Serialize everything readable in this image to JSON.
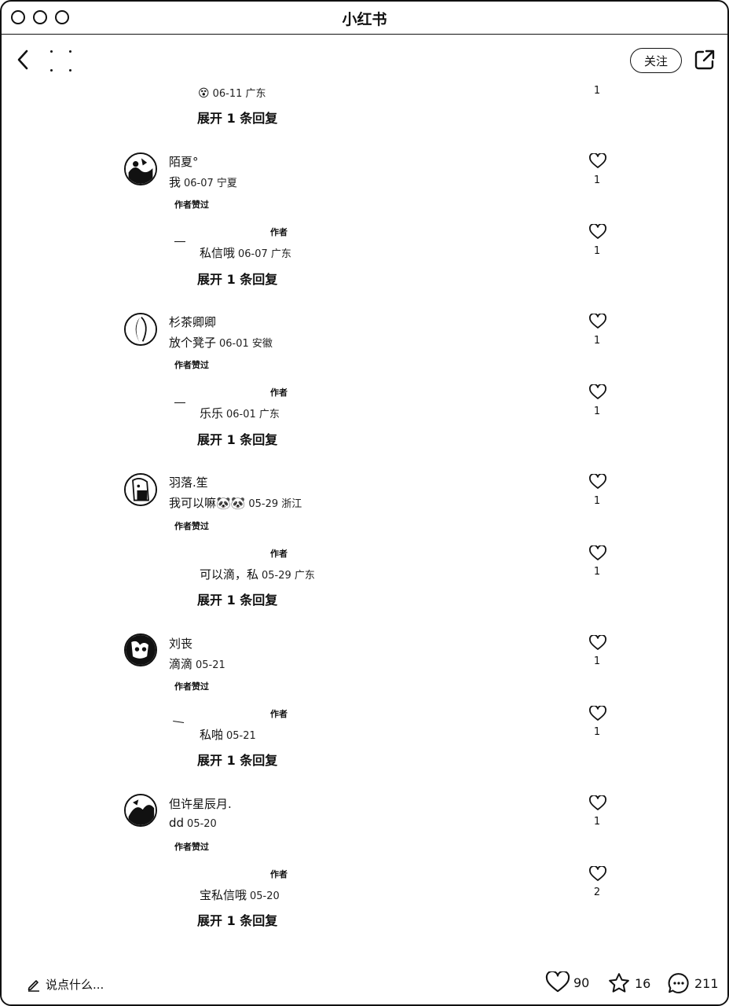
{
  "window": {
    "title": "小红书"
  },
  "nav": {
    "follow_label": "关注"
  },
  "top_partial": {
    "meta": "06-11 广东",
    "likes": "1",
    "expand": "展开 1 条回复"
  },
  "comments": [
    {
      "name": "陌夏°",
      "text": "我",
      "meta": "06-07 宁夏",
      "likes": "1",
      "badge": "作者赞过",
      "reply": {
        "author_tag": "作者",
        "text": "私信哦",
        "meta": "06-07 广东",
        "likes": "1"
      },
      "expand": "展开 1 条回复"
    },
    {
      "name": "杉茶卿卿",
      "text": "放个凳子",
      "meta": "06-01 安徽",
      "likes": "1",
      "badge": "作者赞过",
      "reply": {
        "author_tag": "作者",
        "text": "乐乐",
        "meta": "06-01 广东",
        "likes": "1"
      },
      "expand": "展开 1 条回复"
    },
    {
      "name": "羽落.笙",
      "text": "我可以嘛🐼🐼",
      "meta": "05-29 浙江",
      "likes": "1",
      "badge": "作者赞过",
      "reply": {
        "author_tag": "作者",
        "text": "可以滴，私",
        "meta": "05-29 广东",
        "likes": "1"
      },
      "expand": "展开 1 条回复"
    },
    {
      "name": "刘丧",
      "text": "滴滴",
      "meta": "05-21",
      "likes": "1",
      "badge": "作者赞过",
      "reply": {
        "author_tag": "作者",
        "text": "私啪",
        "meta": "05-21",
        "likes": "1"
      },
      "expand": "展开 1 条回复"
    },
    {
      "name": "但许星辰月.",
      "text": "dd",
      "meta": "05-20",
      "likes": "1",
      "badge": "作者赞过",
      "reply": {
        "author_tag": "作者",
        "text": "宝私信哦",
        "meta": "05-20",
        "likes": "2"
      },
      "expand": "展开 1 条回复"
    }
  ],
  "bottom": {
    "say_placeholder": "说点什么...",
    "likes": "90",
    "collects": "16",
    "comments": "211"
  }
}
